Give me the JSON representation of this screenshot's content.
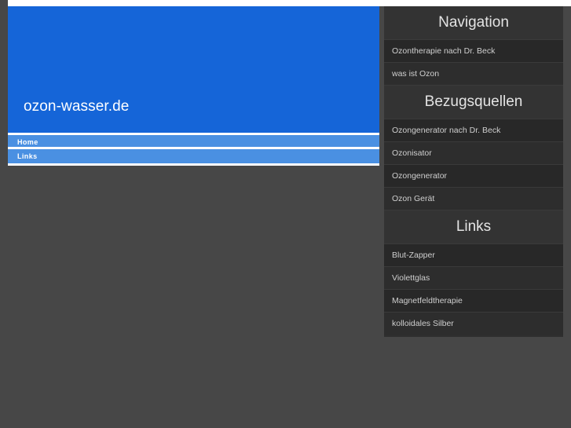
{
  "site": {
    "logo_text": "ozon-wasser.de",
    "header_color": "#1565d8",
    "menu_color": "#4a90e2",
    "page_background": "#474747",
    "sidebar_background": "#2f2f2f"
  },
  "menu": {
    "items": [
      {
        "label": "Home"
      },
      {
        "label": "Links"
      }
    ]
  },
  "sidebar": {
    "sections": [
      {
        "title": "Navigation",
        "links": [
          {
            "label": "Ozontherapie nach Dr. Beck"
          },
          {
            "label": "was ist Ozon"
          }
        ]
      },
      {
        "title": "Bezugsquellen",
        "links": [
          {
            "label": "Ozongenerator nach Dr. Beck"
          },
          {
            "label": "Ozonisator"
          },
          {
            "label": "Ozongenerator"
          },
          {
            "label": "Ozon Gerät"
          }
        ]
      },
      {
        "title": "Links",
        "links": [
          {
            "label": "Blut-Zapper"
          },
          {
            "label": "Violettglas"
          },
          {
            "label": "Magnetfeldtherapie"
          },
          {
            "label": "kolloidales Silber"
          }
        ]
      }
    ]
  }
}
